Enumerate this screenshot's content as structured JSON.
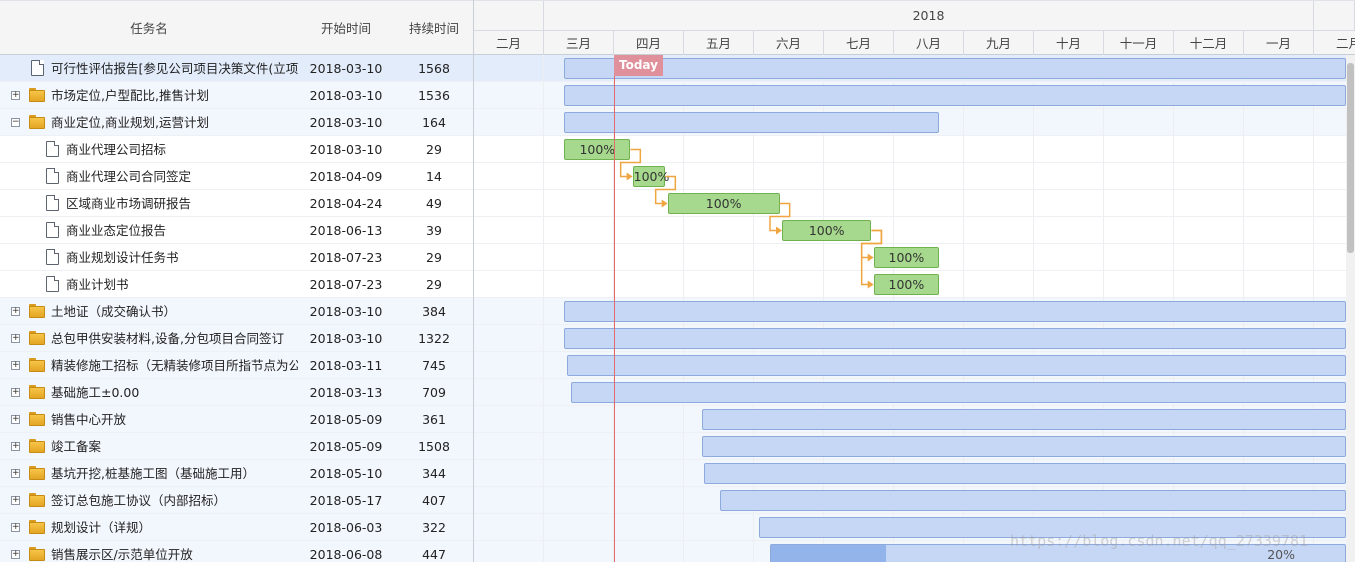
{
  "grid": {
    "columns": {
      "name": "任务名",
      "start": "开始时间",
      "duration": "持续时间"
    },
    "rows": [
      {
        "name": "可行性评估报告[参见公司项目决策文件(立项)]",
        "start": "2018-03-10",
        "duration": "1568",
        "kind": "doc-root",
        "style": "selected"
      },
      {
        "name": "市场定位,户型配比,推售计划",
        "start": "2018-03-10",
        "duration": "1536",
        "kind": "folder",
        "expander": "+",
        "style": "summary"
      },
      {
        "name": "商业定位,商业规划,运营计划",
        "start": "2018-03-10",
        "duration": "164",
        "kind": "folder-open",
        "expander": "−",
        "style": "summary"
      },
      {
        "name": "商业代理公司招标",
        "start": "2018-03-10",
        "duration": "29",
        "kind": "doc-child",
        "style": "normal"
      },
      {
        "name": "商业代理公司合同签定",
        "start": "2018-04-09",
        "duration": "14",
        "kind": "doc-child",
        "style": "normal"
      },
      {
        "name": "区域商业市场调研报告",
        "start": "2018-04-24",
        "duration": "49",
        "kind": "doc-child",
        "style": "normal"
      },
      {
        "name": "商业业态定位报告",
        "start": "2018-06-13",
        "duration": "39",
        "kind": "doc-child",
        "style": "normal"
      },
      {
        "name": "商业规划设计任务书",
        "start": "2018-07-23",
        "duration": "29",
        "kind": "doc-child",
        "style": "normal"
      },
      {
        "name": "商业计划书",
        "start": "2018-07-23",
        "duration": "29",
        "kind": "doc-child",
        "style": "normal"
      },
      {
        "name": "土地证（成交确认书）",
        "start": "2018-03-10",
        "duration": "384",
        "kind": "folder",
        "expander": "+",
        "style": "summary"
      },
      {
        "name": "总包甲供安装材料,设备,分包项目合同签订",
        "start": "2018-03-10",
        "duration": "1322",
        "kind": "folder",
        "expander": "+",
        "style": "summary"
      },
      {
        "name": "精装修施工招标（无精装修项目所指节点为公开",
        "start": "2018-03-11",
        "duration": "745",
        "kind": "folder",
        "expander": "+",
        "style": "summary"
      },
      {
        "name": "基础施工±0.00",
        "start": "2018-03-13",
        "duration": "709",
        "kind": "folder",
        "expander": "+",
        "style": "summary"
      },
      {
        "name": "销售中心开放",
        "start": "2018-05-09",
        "duration": "361",
        "kind": "folder",
        "expander": "+",
        "style": "summary"
      },
      {
        "name": "竣工备案",
        "start": "2018-05-09",
        "duration": "1508",
        "kind": "folder",
        "expander": "+",
        "style": "summary"
      },
      {
        "name": "基坑开挖,桩基施工图（基础施工用）",
        "start": "2018-05-10",
        "duration": "344",
        "kind": "folder",
        "expander": "+",
        "style": "summary"
      },
      {
        "name": "签订总包施工协议（内部招标）",
        "start": "2018-05-17",
        "duration": "407",
        "kind": "folder",
        "expander": "+",
        "style": "summary"
      },
      {
        "name": "规划设计（详规）",
        "start": "2018-06-03",
        "duration": "322",
        "kind": "folder",
        "expander": "+",
        "style": "summary"
      },
      {
        "name": "销售展示区/示范单位开放",
        "start": "2018-06-08",
        "duration": "447",
        "kind": "folder",
        "expander": "+",
        "style": "summary"
      }
    ]
  },
  "timeline": {
    "years": [
      "",
      "2018",
      ""
    ],
    "months": [
      "二月",
      "三月",
      "四月",
      "五月",
      "六月",
      "七月",
      "八月",
      "九月",
      "十月",
      "十一月",
      "十二月",
      "一月",
      "二月"
    ],
    "today_label": "Today",
    "bars": [
      {
        "type": "summary",
        "start": "2018-03-10",
        "duration_days": 1568
      },
      {
        "type": "summary",
        "start": "2018-03-10",
        "duration_days": 1536
      },
      {
        "type": "summary",
        "start": "2018-03-10",
        "duration_days": 164
      },
      {
        "type": "task",
        "start": "2018-03-10",
        "duration_days": 29,
        "label": "100%"
      },
      {
        "type": "task",
        "start": "2018-04-09",
        "duration_days": 14,
        "label": "100%"
      },
      {
        "type": "task",
        "start": "2018-04-24",
        "duration_days": 49,
        "label": "100%"
      },
      {
        "type": "task",
        "start": "2018-06-13",
        "duration_days": 39,
        "label": "100%"
      },
      {
        "type": "task",
        "start": "2018-07-23",
        "duration_days": 29,
        "label": "100%"
      },
      {
        "type": "task",
        "start": "2018-07-23",
        "duration_days": 29,
        "label": "100%"
      },
      {
        "type": "summary",
        "start": "2018-03-10",
        "duration_days": 384
      },
      {
        "type": "summary",
        "start": "2018-03-10",
        "duration_days": 1322
      },
      {
        "type": "summary",
        "start": "2018-03-11",
        "duration_days": 745
      },
      {
        "type": "summary",
        "start": "2018-03-13",
        "duration_days": 709
      },
      {
        "type": "summary",
        "start": "2018-05-09",
        "duration_days": 361
      },
      {
        "type": "summary",
        "start": "2018-05-09",
        "duration_days": 1508
      },
      {
        "type": "summary",
        "start": "2018-05-10",
        "duration_days": 344
      },
      {
        "type": "summary",
        "start": "2018-05-17",
        "duration_days": 407
      },
      {
        "type": "summary",
        "start": "2018-06-03",
        "duration_days": 322
      },
      {
        "type": "progress",
        "start": "2018-06-08",
        "duration_days": 447,
        "label": "20%",
        "progress": 0.2
      }
    ],
    "links": [
      [
        3,
        4
      ],
      [
        4,
        5
      ],
      [
        5,
        6
      ],
      [
        6,
        7
      ],
      [
        6,
        8
      ]
    ]
  },
  "watermark": "https://blog.csdn.net/qq_27339781",
  "colors": {
    "summary_bar": "#c6d7f5",
    "task_bar": "#a6d98d",
    "today": "#e26a6a",
    "link": "#f0a640"
  }
}
